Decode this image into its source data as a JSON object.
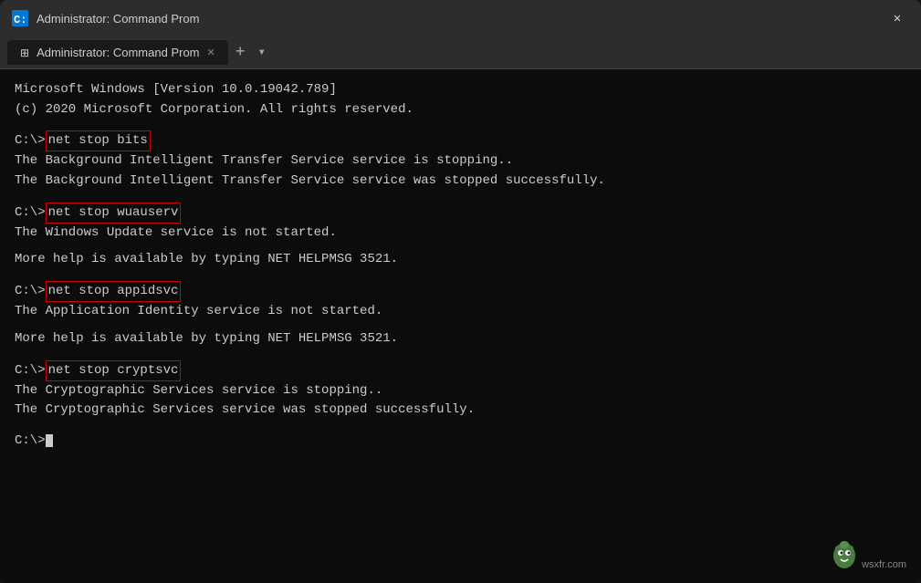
{
  "titlebar": {
    "title": "Administrator: Command Prom",
    "close_label": "✕",
    "new_tab_label": "+",
    "dropdown_label": "▾"
  },
  "tab": {
    "label": "Administrator: Command Prom",
    "close_label": "✕"
  },
  "terminal": {
    "line1": "Microsoft Windows [Version 10.0.19042.789]",
    "line2": "(c) 2020 Microsoft Corporation. All rights reserved.",
    "line3": "",
    "cmd1_prompt": "C:\\>",
    "cmd1": "net stop bits",
    "line4": "The Background Intelligent Transfer Service service is stopping..",
    "line5": "The Background Intelligent Transfer Service service was stopped successfully.",
    "line6": "",
    "cmd2_prompt": "C:\\>",
    "cmd2": "net stop wuauserv",
    "line7": "The Windows Update service is not started.",
    "line8": "",
    "line9": "More help is available by typing NET HELPMSG 3521.",
    "line10": "",
    "cmd3_prompt": "C:\\>",
    "cmd3": "net stop appidsvc",
    "line11": "The Application Identity service is not started.",
    "line12": "",
    "line13": "More help is available by typing NET HELPMSG 3521.",
    "line14": "",
    "cmd4_prompt": "C:\\>",
    "cmd4": "net stop cryptsvc",
    "line15": "The Cryptographic Services service is stopping..",
    "line16": "The Cryptographic Services service was stopped successfully.",
    "line17": "",
    "final_prompt": "C:\\>"
  },
  "watermark": {
    "text": "wsxfr.com"
  }
}
